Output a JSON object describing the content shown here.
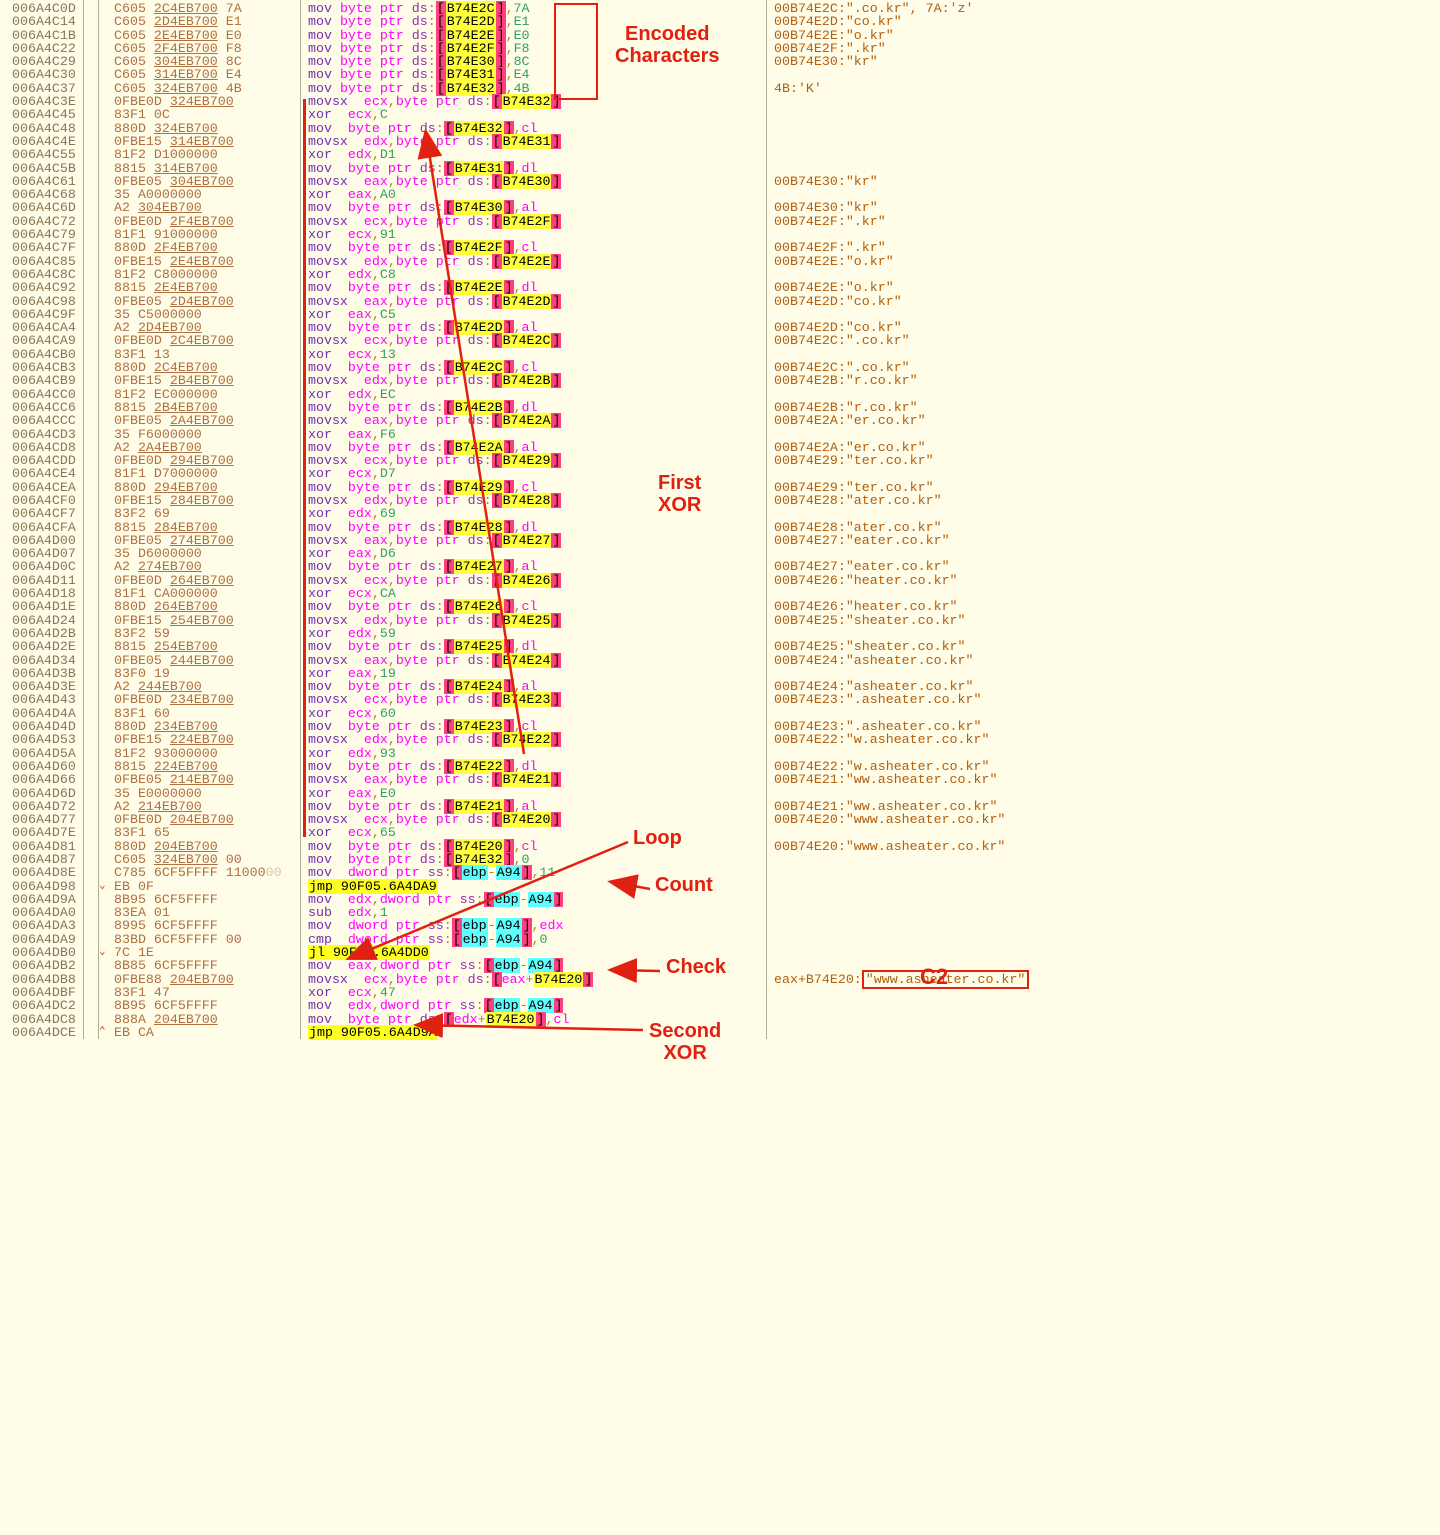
{
  "annotations": {
    "encoded": "Encoded\nCharacters",
    "firstxor": "First\nXOR",
    "loop": "Loop",
    "count": "Count",
    "check": "Check",
    "secondxor": "Second\nXOR",
    "c2": "C2",
    "c2val": "\"www.asheater.co.kr\""
  },
  "rows": [
    {
      "a": "006A4C0D",
      "h": "C605 <u>2C4EB700</u> 7A",
      "asm": "<m>mov</m> <r>byte ptr</r> <s>ds</s>:[<op>B74E2C</op>],<im>7A</im>",
      "c": "00B74E2C:\".co.kr\", 7A:'z'"
    },
    {
      "a": "006A4C14",
      "h": "C605 <u>2D4EB700</u> E1",
      "asm": "<m>mov</m> <r>byte ptr</r> <s>ds</s>:[<op>B74E2D</op>],<im>E1</im>",
      "c": "00B74E2D:\"co.kr\""
    },
    {
      "a": "006A4C1B",
      "h": "C605 <u>2E4EB700</u> E0",
      "asm": "<m>mov</m> <r>byte ptr</r> <s>ds</s>:[<op>B74E2E</op>],<im>E0</im>",
      "c": "00B74E2E:\"o.kr\""
    },
    {
      "a": "006A4C22",
      "h": "C605 <u>2F4EB700</u> F8",
      "asm": "<m>mov</m> <r>byte ptr</r> <s>ds</s>:[<op>B74E2F</op>],<im>F8</im>",
      "c": "00B74E2F:\".kr\""
    },
    {
      "a": "006A4C29",
      "h": "C605 <u>304EB700</u> 8C",
      "asm": "<m>mov</m> <r>byte ptr</r> <s>ds</s>:[<op>B74E30</op>],<im>8C</im>",
      "c": "00B74E30:\"kr\""
    },
    {
      "a": "006A4C30",
      "h": "C605 <u>314EB700</u> E4",
      "asm": "<m>mov</m> <r>byte ptr</r> <s>ds</s>:[<op>B74E31</op>],<im>E4</im>",
      "c": ""
    },
    {
      "a": "006A4C37",
      "h": "C605 <u>324EB700</u> 4B",
      "asm": "<m>mov</m> <r>byte ptr</r> <s>ds</s>:[<op>B74E32</op>],<im>4B</im>",
      "c": "4B:'K'"
    },
    {
      "a": "006A4C3E",
      "h": "0FBE0D <u>324EB700</u>",
      "asm": "<m>movsx</m>  <r>ecx</r>,<r>byte ptr</r> <s>ds</s>:[<op>B74E32</op>]",
      "c": "",
      "xorbar": true
    },
    {
      "a": "006A4C45",
      "h": "83F1 0C",
      "asm": "<m>xor</m>  <r>ecx</r>,<im>C</im>",
      "c": ""
    },
    {
      "a": "006A4C48",
      "h": "880D <u>324EB700</u>",
      "asm": "<m>mov</m>  <r>byte ptr</r> <s>ds</s>:[<op>B74E32</op>],<r>cl</r>",
      "c": ""
    },
    {
      "a": "006A4C4E",
      "h": "0FBE15 <u>314EB700</u>",
      "asm": "<m>movsx</m>  <r>edx</r>,<r>byte ptr</r> <s>ds</s>:[<op>B74E31</op>]",
      "c": ""
    },
    {
      "a": "006A4C55",
      "h": "81F2 D1000000",
      "asm": "<m>xor</m>  <r>edx</r>,<im>D1</im>",
      "c": ""
    },
    {
      "a": "006A4C5B",
      "h": "8815 <u>314EB700</u>",
      "asm": "<m>mov</m>  <r>byte ptr</r> <s>ds</s>:[<op>B74E31</op>],<r>dl</r>",
      "c": ""
    },
    {
      "a": "006A4C61",
      "h": "0FBE05 <u>304EB700</u>",
      "asm": "<m>movsx</m>  <r>eax</r>,<r>byte ptr</r> <s>ds</s>:[<op>B74E30</op>]",
      "c": "00B74E30:\"kr\""
    },
    {
      "a": "006A4C68",
      "h": "35 A0000000",
      "asm": "<m>xor</m>  <r>eax</r>,<im>A0</im>",
      "c": ""
    },
    {
      "a": "006A4C6D",
      "h": "A2 <u>304EB700</u>",
      "asm": "<m>mov</m>  <r>byte ptr</r> <s>ds</s>:[<op>B74E30</op>],<r>al</r>",
      "c": "00B74E30:\"kr\""
    },
    {
      "a": "006A4C72",
      "h": "0FBE0D <u>2F4EB700</u>",
      "asm": "<m>movsx</m>  <r>ecx</r>,<r>byte ptr</r> <s>ds</s>:[<op>B74E2F</op>]",
      "c": "00B74E2F:\".kr\""
    },
    {
      "a": "006A4C79",
      "h": "81F1 91000000",
      "asm": "<m>xor</m>  <r>ecx</r>,<im>91</im>",
      "c": ""
    },
    {
      "a": "006A4C7F",
      "h": "880D <u>2F4EB700</u>",
      "asm": "<m>mov</m>  <r>byte ptr</r> <s>ds</s>:[<op>B74E2F</op>],<r>cl</r>",
      "c": "00B74E2F:\".kr\""
    },
    {
      "a": "006A4C85",
      "h": "0FBE15 <u>2E4EB700</u>",
      "asm": "<m>movsx</m>  <r>edx</r>,<r>byte ptr</r> <s>ds</s>:[<op>B74E2E</op>]",
      "c": "00B74E2E:\"o.kr\""
    },
    {
      "a": "006A4C8C",
      "h": "81F2 C8000000",
      "asm": "<m>xor</m>  <r>edx</r>,<im>C8</im>",
      "c": ""
    },
    {
      "a": "006A4C92",
      "h": "8815 <u>2E4EB700</u>",
      "asm": "<m>mov</m>  <r>byte ptr</r> <s>ds</s>:[<op>B74E2E</op>],<r>dl</r>",
      "c": "00B74E2E:\"o.kr\""
    },
    {
      "a": "006A4C98",
      "h": "0FBE05 <u>2D4EB700</u>",
      "asm": "<m>movsx</m>  <r>eax</r>,<r>byte ptr</r> <s>ds</s>:[<op>B74E2D</op>]",
      "c": "00B74E2D:\"co.kr\""
    },
    {
      "a": "006A4C9F",
      "h": "35 C5000000",
      "asm": "<m>xor</m>  <r>eax</r>,<im>C5</im>",
      "c": ""
    },
    {
      "a": "006A4CA4",
      "h": "A2 <u>2D4EB700</u>",
      "asm": "<m>mov</m>  <r>byte ptr</r> <s>ds</s>:[<op>B74E2D</op>],<r>al</r>",
      "c": "00B74E2D:\"co.kr\""
    },
    {
      "a": "006A4CA9",
      "h": "0FBE0D <u>2C4EB700</u>",
      "asm": "<m>movsx</m>  <r>ecx</r>,<r>byte ptr</r> <s>ds</s>:[<op>B74E2C</op>]",
      "c": "00B74E2C:\".co.kr\""
    },
    {
      "a": "006A4CB0",
      "h": "83F1 13",
      "asm": "<m>xor</m>  <r>ecx</r>,<im>13</im>",
      "c": ""
    },
    {
      "a": "006A4CB3",
      "h": "880D <u>2C4EB700</u>",
      "asm": "<m>mov</m>  <r>byte ptr</r> <s>ds</s>:[<op>B74E2C</op>],<r>cl</r>",
      "c": "00B74E2C:\".co.kr\""
    },
    {
      "a": "006A4CB9",
      "h": "0FBE15 <u>2B4EB700</u>",
      "asm": "<m>movsx</m>  <r>edx</r>,<r>byte ptr</r> <s>ds</s>:[<op>B74E2B</op>]",
      "c": "00B74E2B:\"r.co.kr\""
    },
    {
      "a": "006A4CC0",
      "h": "81F2 EC000000",
      "asm": "<m>xor</m>  <r>edx</r>,<im>EC</im>",
      "c": ""
    },
    {
      "a": "006A4CC6",
      "h": "8815 <u>2B4EB700</u>",
      "asm": "<m>mov</m>  <r>byte ptr</r> <s>ds</s>:[<op>B74E2B</op>],<r>dl</r>",
      "c": "00B74E2B:\"r.co.kr\""
    },
    {
      "a": "006A4CCC",
      "h": "0FBE05 <u>2A4EB700</u>",
      "asm": "<m>movsx</m>  <r>eax</r>,<r>byte ptr</r> <s>ds</s>:[<op>B74E2A</op>]",
      "c": "00B74E2A:\"er.co.kr\""
    },
    {
      "a": "006A4CD3",
      "h": "35 F6000000",
      "asm": "<m>xor</m>  <r>eax</r>,<im>F6</im>",
      "c": ""
    },
    {
      "a": "006A4CD8",
      "h": "A2 <u>2A4EB700</u>",
      "asm": "<m>mov</m>  <r>byte ptr</r> <s>ds</s>:[<op>B74E2A</op>],<r>al</r>",
      "c": "00B74E2A:\"er.co.kr\""
    },
    {
      "a": "006A4CDD",
      "h": "0FBE0D <u>294EB700</u>",
      "asm": "<m>movsx</m>  <r>ecx</r>,<r>byte ptr</r> <s>ds</s>:[<op>B74E29</op>]",
      "c": "00B74E29:\"ter.co.kr\""
    },
    {
      "a": "006A4CE4",
      "h": "81F1 D7000000",
      "asm": "<m>xor</m>  <r>ecx</r>,<im>D7</im>",
      "c": ""
    },
    {
      "a": "006A4CEA",
      "h": "880D <u>294EB700</u>",
      "asm": "<m>mov</m>  <r>byte ptr</r> <s>ds</s>:[<op>B74E29</op>],<r>cl</r>",
      "c": "00B74E29:\"ter.co.kr\""
    },
    {
      "a": "006A4CF0",
      "h": "0FBE15 <u>284EB700</u>",
      "asm": "<m>movsx</m>  <r>edx</r>,<r>byte ptr</r> <s>ds</s>:[<op>B74E28</op>]",
      "c": "00B74E28:\"ater.co.kr\""
    },
    {
      "a": "006A4CF7",
      "h": "83F2 69",
      "asm": "<m>xor</m>  <r>edx</r>,<im>69</im>",
      "c": ""
    },
    {
      "a": "006A4CFA",
      "h": "8815 <u>284EB700</u>",
      "asm": "<m>mov</m>  <r>byte ptr</r> <s>ds</s>:[<op>B74E28</op>],<r>dl</r>",
      "c": "00B74E28:\"ater.co.kr\""
    },
    {
      "a": "006A4D00",
      "h": "0FBE05 <u>274EB700</u>",
      "asm": "<m>movsx</m>  <r>eax</r>,<r>byte ptr</r> <s>ds</s>:[<op>B74E27</op>]",
      "c": "00B74E27:\"eater.co.kr\""
    },
    {
      "a": "006A4D07",
      "h": "35 D6000000",
      "asm": "<m>xor</m>  <r>eax</r>,<im>D6</im>",
      "c": ""
    },
    {
      "a": "006A4D0C",
      "h": "A2 <u>274EB700</u>",
      "asm": "<m>mov</m>  <r>byte ptr</r> <s>ds</s>:[<op>B74E27</op>],<r>al</r>",
      "c": "00B74E27:\"eater.co.kr\""
    },
    {
      "a": "006A4D11",
      "h": "0FBE0D <u>264EB700</u>",
      "asm": "<m>movsx</m>  <r>ecx</r>,<r>byte ptr</r> <s>ds</s>:[<op>B74E26</op>]",
      "c": "00B74E26:\"heater.co.kr\""
    },
    {
      "a": "006A4D18",
      "h": "81F1 CA000000",
      "asm": "<m>xor</m>  <r>ecx</r>,<im>CA</im>",
      "c": ""
    },
    {
      "a": "006A4D1E",
      "h": "880D <u>264EB700</u>",
      "asm": "<m>mov</m>  <r>byte ptr</r> <s>ds</s>:[<op>B74E26</op>],<r>cl</r>",
      "c": "00B74E26:\"heater.co.kr\""
    },
    {
      "a": "006A4D24",
      "h": "0FBE15 <u>254EB700</u>",
      "asm": "<m>movsx</m>  <r>edx</r>,<r>byte ptr</r> <s>ds</s>:[<op>B74E25</op>]",
      "c": "00B74E25:\"sheater.co.kr\""
    },
    {
      "a": "006A4D2B",
      "h": "83F2 59",
      "asm": "<m>xor</m>  <r>edx</r>,<im>59</im>",
      "c": ""
    },
    {
      "a": "006A4D2E",
      "h": "8815 <u>254EB700</u>",
      "asm": "<m>mov</m>  <r>byte ptr</r> <s>ds</s>:[<op>B74E25</op>],<r>dl</r>",
      "c": "00B74E25:\"sheater.co.kr\""
    },
    {
      "a": "006A4D34",
      "h": "0FBE05 <u>244EB700</u>",
      "asm": "<m>movsx</m>  <r>eax</r>,<r>byte ptr</r> <s>ds</s>:[<op>B74E24</op>]",
      "c": "00B74E24:\"asheater.co.kr\""
    },
    {
      "a": "006A4D3B",
      "h": "83F0 19",
      "asm": "<m>xor</m>  <r>eax</r>,<im>19</im>",
      "c": ""
    },
    {
      "a": "006A4D3E",
      "h": "A2 <u>244EB700</u>",
      "asm": "<m>mov</m>  <r>byte ptr</r> <s>ds</s>:[<op>B74E24</op>],<r>al</r>",
      "c": "00B74E24:\"asheater.co.kr\""
    },
    {
      "a": "006A4D43",
      "h": "0FBE0D <u>234EB700</u>",
      "asm": "<m>movsx</m>  <r>ecx</r>,<r>byte ptr</r> <s>ds</s>:[<op>B74E23</op>]",
      "c": "00B74E23:\".asheater.co.kr\""
    },
    {
      "a": "006A4D4A",
      "h": "83F1 60",
      "asm": "<m>xor</m>  <r>ecx</r>,<im>60</im>",
      "c": ""
    },
    {
      "a": "006A4D4D",
      "h": "880D <u>234EB700</u>",
      "asm": "<m>mov</m>  <r>byte ptr</r> <s>ds</s>:[<op>B74E23</op>],<r>cl</r>",
      "c": "00B74E23:\".asheater.co.kr\""
    },
    {
      "a": "006A4D53",
      "h": "0FBE15 <u>224EB700</u>",
      "asm": "<m>movsx</m>  <r>edx</r>,<r>byte ptr</r> <s>ds</s>:[<op>B74E22</op>]",
      "c": "00B74E22:\"w.asheater.co.kr\""
    },
    {
      "a": "006A4D5A",
      "h": "81F2 93000000",
      "asm": "<m>xor</m>  <r>edx</r>,<im>93</im>",
      "c": ""
    },
    {
      "a": "006A4D60",
      "h": "8815 <u>224EB700</u>",
      "asm": "<m>mov</m>  <r>byte ptr</r> <s>ds</s>:[<op>B74E22</op>],<r>dl</r>",
      "c": "00B74E22:\"w.asheater.co.kr\""
    },
    {
      "a": "006A4D66",
      "h": "0FBE05 <u>214EB700</u>",
      "asm": "<m>movsx</m>  <r>eax</r>,<r>byte ptr</r> <s>ds</s>:[<op>B74E21</op>]",
      "c": "00B74E21:\"ww.asheater.co.kr\""
    },
    {
      "a": "006A4D6D",
      "h": "35 E0000000",
      "asm": "<m>xor</m>  <r>eax</r>,<im>E0</im>",
      "c": ""
    },
    {
      "a": "006A4D72",
      "h": "A2 <u>214EB700</u>",
      "asm": "<m>mov</m>  <r>byte ptr</r> <s>ds</s>:[<op>B74E21</op>],<r>al</r>",
      "c": "00B74E21:\"ww.asheater.co.kr\""
    },
    {
      "a": "006A4D77",
      "h": "0FBE0D <u>204EB700</u>",
      "asm": "<m>movsx</m>  <r>ecx</r>,<r>byte ptr</r> <s>ds</s>:[<op>B74E20</op>]",
      "c": "00B74E20:\"www.asheater.co.kr\""
    },
    {
      "a": "006A4D7E",
      "h": "83F1 65",
      "asm": "<m>xor</m>  <r>ecx</r>,<im>65</im>",
      "c": "",
      "xorend": true
    },
    {
      "a": "006A4D81",
      "h": "880D <u>204EB700</u>",
      "asm": "<m>mov</m>  <r>byte ptr</r> <s>ds</s>:[<op>B74E20</op>],<r>cl</r>",
      "c": "00B74E20:\"www.asheater.co.kr\""
    },
    {
      "a": "006A4D87",
      "h": "C605 <u>324EB700</u> 00",
      "asm": "<m>mov</m>  <r>byte ptr</r> <s>ds</s>:[<op>B74E32</op>],<im>0</im>",
      "c": ""
    },
    {
      "a": "006A4D8E",
      "h": "C785 6CF5FFFF 11000<span style='opacity:.4'>00</span>",
      "asm": "<m>mov</m>  <r>dword ptr</r> <s>ss</s>:[<hl4>ebp</hl4>-<hl4>A94</hl4>],<im>11</im>",
      "c": ""
    },
    {
      "a": "006A4D98",
      "h": "EB 0F",
      "asm": "<hl3>jmp 90F05.6A4DA9</hl3>",
      "c": "",
      "chev": "v"
    },
    {
      "a": "006A4D9A",
      "h": "8B95 6CF5FFFF",
      "asm": "<m>mov</m>  <r>edx</r>,<r>dword ptr</r> <s>ss</s>:[<hl4>ebp</hl4>-<hl4>A94</hl4>]",
      "c": ""
    },
    {
      "a": "006A4DA0",
      "h": "83EA 01",
      "asm": "<m>sub</m>  <r>edx</r>,<im>1</im>",
      "c": ""
    },
    {
      "a": "006A4DA3",
      "h": "8995 6CF5FFFF",
      "asm": "<m>mov</m>  <r>dword ptr</r> <s>ss</s>:[<hl4>ebp</hl4>-<hl4>A94</hl4>],<r>edx</r>",
      "c": ""
    },
    {
      "a": "006A4DA9",
      "h": "83BD 6CF5FFFF 00",
      "asm": "<m>cmp</m>  <r>dword ptr</r> <s>ss</s>:[<hl4>ebp</hl4>-<hl4>A94</hl4>],<im>0</im>",
      "c": ""
    },
    {
      "a": "006A4DB0",
      "h": "7C 1E",
      "asm": "<hl3>jl 90F05.6A4DD0</hl3>",
      "c": "",
      "chev": "v"
    },
    {
      "a": "006A4DB2",
      "h": "8B85 6CF5FFFF",
      "asm": "<m>mov</m>  <r>eax</r>,<r>dword ptr</r> <s>ss</s>:[<hl4>ebp</hl4>-<hl4>A94</hl4>]",
      "c": ""
    },
    {
      "a": "006A4DB8",
      "h": "0FBE88 <u>204EB700</u>",
      "asm": "<m>movsx</m>  <r>ecx</r>,<r>byte ptr</r> <s>ds</s>:[<r>eax</r>+<op>B74E20</op>]",
      "c": "eax+B74E20:<box>\"www.asheater.co.kr\"</box>"
    },
    {
      "a": "006A4DBF",
      "h": "83F1 47",
      "asm": "<m>xor</m>  <r>ecx</r>,<im>47</im>",
      "c": ""
    },
    {
      "a": "006A4DC2",
      "h": "8B95 6CF5FFFF",
      "asm": "<m>mov</m>  <r>edx</r>,<r>dword ptr</r> <s>ss</s>:[<hl4>ebp</hl4>-<hl4>A94</hl4>]",
      "c": ""
    },
    {
      "a": "006A4DC8",
      "h": "888A <u>204EB700</u>",
      "asm": "<m>mov</m>  <r>byte ptr</r> <s>ds</s>:[<r>edx</r>+<op>B74E20</op>],<r>cl</r>",
      "c": ""
    },
    {
      "a": "006A4DCE",
      "h": "EB CA",
      "asm": "<hl3>jmp 90F05.6A4D9A</hl3>",
      "c": "",
      "chev": "^"
    }
  ]
}
